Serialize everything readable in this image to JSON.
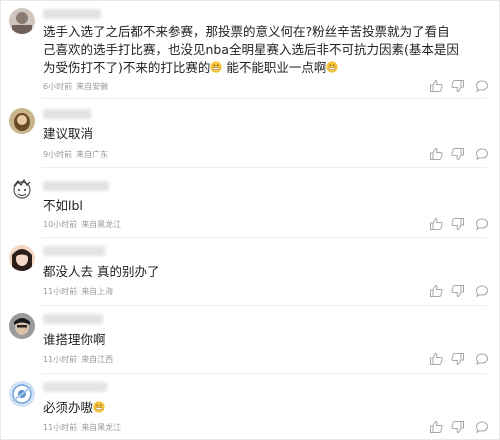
{
  "comments": [
    {
      "lines": [
        "选手入选了之后都不来参赛，那投票的意义何在?粉丝辛苦投票就为了看自",
        "己喜欢的选手打比赛，也没见nba全明星赛入选后非不可抗力因素(基本是因",
        "为受伤打不了)不来的打比赛的",
        " 能不能职业一点啊"
      ],
      "time": "6小时前",
      "location": "来自安徽"
    },
    {
      "text": "建议取消",
      "time": "9小时前",
      "location": "来自广东"
    },
    {
      "text": "不如lbl",
      "time": "10小时前",
      "location": "来自黑龙江"
    },
    {
      "text": "都没人去 真的别办了",
      "time": "11小时前",
      "location": "来自上海"
    },
    {
      "text": "谁搭理你啊",
      "time": "11小时前",
      "location": "来自江西"
    },
    {
      "text": "必须办嗷",
      "time": "11小时前",
      "location": "来自黑龙江"
    }
  ],
  "icons": {
    "like": "thumbs-up-icon",
    "dislike": "thumbs-down-icon",
    "reply": "comment-bubble-icon",
    "emoji": "grimace-emoji-icon"
  },
  "colors": {
    "text": "#1f1f1f",
    "meta": "#9a9a9a",
    "icon": "#a8a8a8",
    "divider": "#ededed"
  }
}
